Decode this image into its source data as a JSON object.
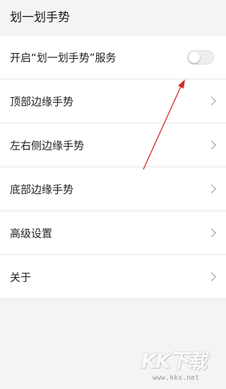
{
  "header": {
    "title": "划一划手势"
  },
  "settings": {
    "service_toggle": {
      "label": "开启“划一划手势”服务",
      "enabled": false
    },
    "items": [
      {
        "label": "顶部边缘手势",
        "icon": "chevron-right-icon"
      },
      {
        "label": "左右侧边缘手势",
        "icon": "chevron-right-icon"
      },
      {
        "label": "底部边缘手势",
        "icon": "chevron-right-icon"
      },
      {
        "label": "高级设置",
        "icon": "chevron-right-icon"
      },
      {
        "label": "关于",
        "icon": "chevron-right-icon"
      }
    ]
  },
  "annotation": {
    "arrow_color": "#d12a2a",
    "points_to": "service-toggle"
  },
  "watermark": {
    "logo": "KK下载",
    "url": "www.kkx.net"
  },
  "colors": {
    "background": "#f4f4f4",
    "row_background": "#ffffff",
    "divider": "#e6e6e6",
    "chevron": "#9a9a9a"
  }
}
